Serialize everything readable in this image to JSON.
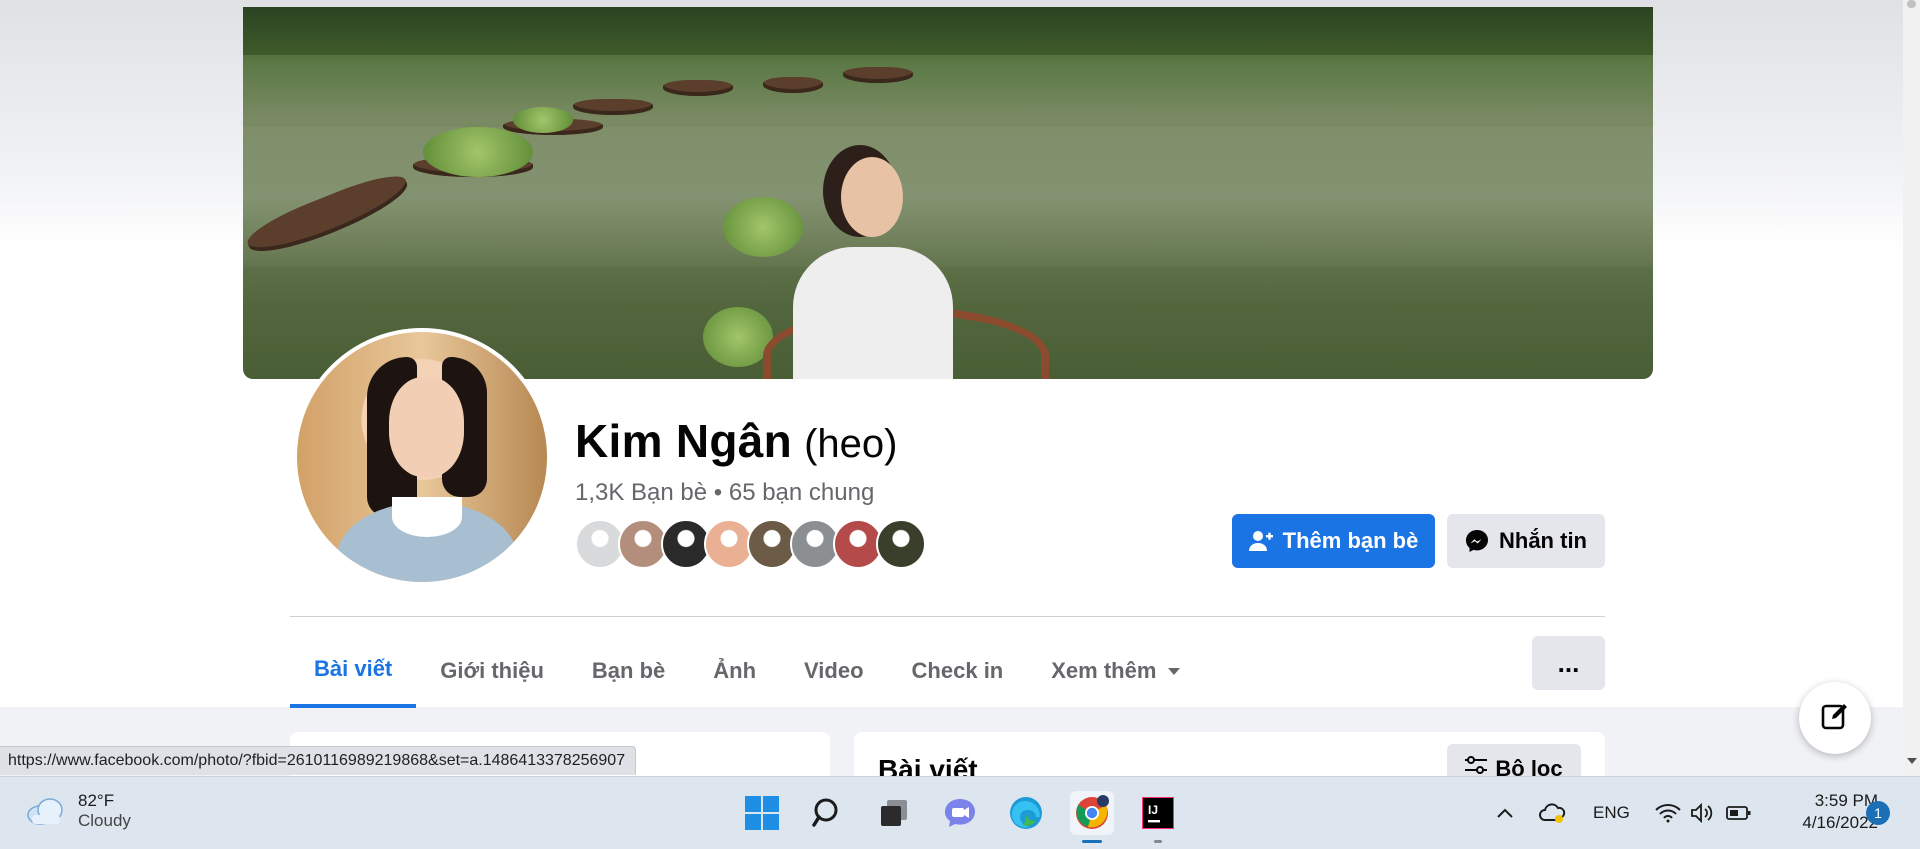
{
  "profile": {
    "name": "Kim Ngân",
    "alternate_name": "(heo)",
    "friends_summary": "1,3K Bạn bè • 65 bạn chung",
    "mutual_friend_colors": [
      "#d9dadc",
      "#b48e7c",
      "#2a2a2a",
      "#e9b093",
      "#6b5a46",
      "#8c8f92",
      "#b54a4a",
      "#3a3f2c"
    ]
  },
  "actions": {
    "add_friend": "Thêm bạn bè",
    "message": "Nhắn tin",
    "more": "..."
  },
  "tabs": [
    {
      "label": "Bài viết",
      "active": true
    },
    {
      "label": "Giới thiệu",
      "active": false
    },
    {
      "label": "Bạn bè",
      "active": false
    },
    {
      "label": "Ảnh",
      "active": false
    },
    {
      "label": "Video",
      "active": false
    },
    {
      "label": "Check in",
      "active": false
    },
    {
      "label": "Xem thêm",
      "active": false
    }
  ],
  "posts_card": {
    "title": "Bài viết",
    "filter_label": "Bộ lọc"
  },
  "status_bar": {
    "url": "https://www.facebook.com/photo/?fbid=2610116989219868&set=a.1486413378256907"
  },
  "taskbar": {
    "weather_temp": "82°F",
    "weather_desc": "Cloudy",
    "language": "ENG",
    "time": "3:59 PM",
    "date": "4/16/2022",
    "notification_count": "1",
    "apps": [
      "windows-start-icon",
      "search-icon",
      "task-view-icon",
      "teams-chat-icon",
      "edge-icon",
      "chrome-icon",
      "intellij-icon"
    ]
  },
  "colors": {
    "primary": "#1b74e4",
    "secondary_button": "#e4e6eb",
    "muted_text": "#65676b"
  }
}
